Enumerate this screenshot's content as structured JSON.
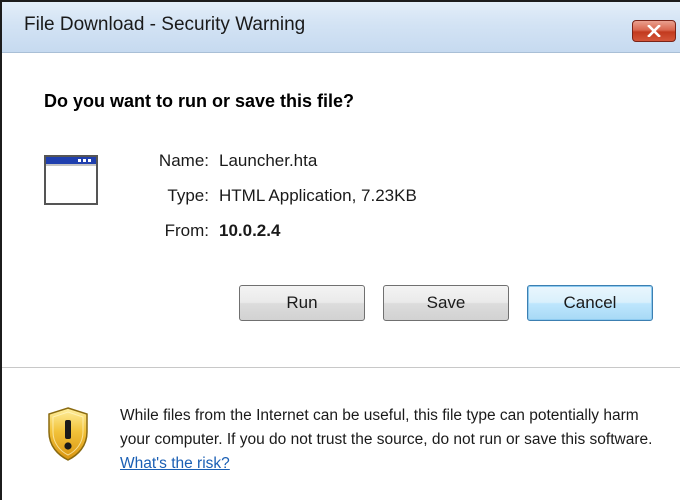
{
  "window": {
    "title": "File Download - Security Warning",
    "close_icon": "close-icon"
  },
  "dialog": {
    "question": "Do you want to run or save this file?",
    "file_icon": "application-window-icon",
    "name_label": "Name:",
    "name_value": "Launcher.hta",
    "type_label": "Type:",
    "type_value": "HTML Application, 7.23KB",
    "from_label": "From:",
    "from_value": "10.0.2.4"
  },
  "buttons": {
    "run": "Run",
    "save": "Save",
    "cancel": "Cancel"
  },
  "warning": {
    "icon": "security-shield-icon",
    "text": "While files from the Internet can be useful, this file type can potentially harm your computer. If you do not trust the source, do not run or save this software.",
    "link": "What's the risk?"
  },
  "colors": {
    "titlebar": "#d3e3f4",
    "close_button": "#c9442a",
    "link": "#1a5fb4",
    "default_button_border": "#3c7fb1"
  }
}
